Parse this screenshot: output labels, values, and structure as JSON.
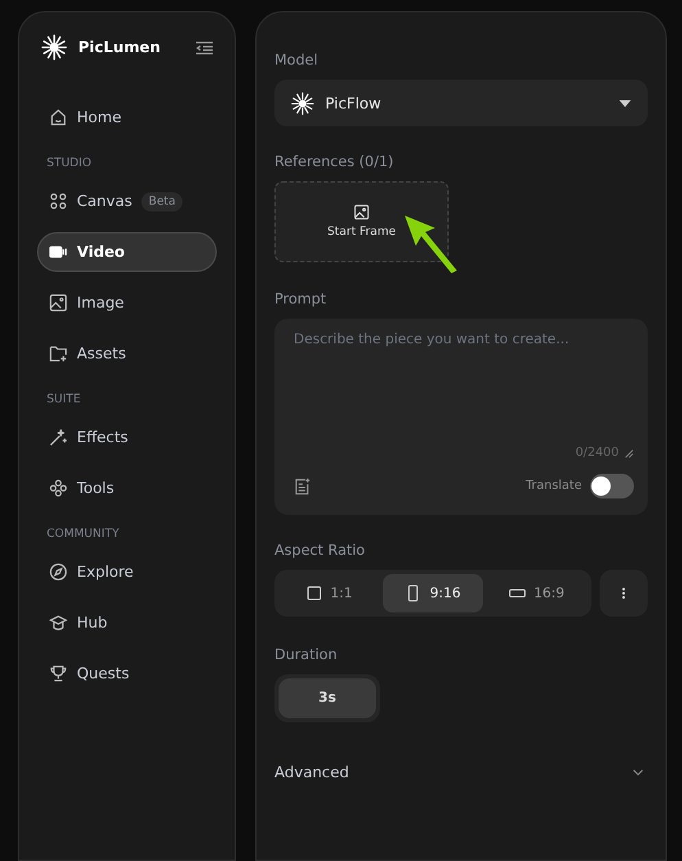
{
  "sidebar": {
    "brand": "PicLumen",
    "items": [
      {
        "kind": "item",
        "label": "Home",
        "selected": false
      },
      {
        "kind": "section",
        "label": "STUDIO"
      },
      {
        "kind": "item",
        "label": "Canvas",
        "badge": "Beta",
        "selected": false
      },
      {
        "kind": "item",
        "label": "Video",
        "selected": true
      },
      {
        "kind": "item",
        "label": "Image",
        "selected": false
      },
      {
        "kind": "item",
        "label": "Assets",
        "selected": false
      },
      {
        "kind": "section",
        "label": "SUITE"
      },
      {
        "kind": "item",
        "label": "Effects",
        "selected": false
      },
      {
        "kind": "item",
        "label": "Tools",
        "selected": false
      },
      {
        "kind": "section",
        "label": "COMMUNITY"
      },
      {
        "kind": "item",
        "label": "Explore",
        "selected": false
      },
      {
        "kind": "item",
        "label": "Hub",
        "selected": false
      },
      {
        "kind": "item",
        "label": "Quests",
        "selected": false
      }
    ]
  },
  "model": {
    "label": "Model",
    "value": "PicFlow"
  },
  "references": {
    "label": "References (0/1)",
    "slot": "Start Frame"
  },
  "prompt": {
    "label": "Prompt",
    "placeholder": "Describe the piece you want to create...",
    "counter": "0/2400",
    "translate": {
      "label": "Translate",
      "on": false
    }
  },
  "aspect_ratio": {
    "label": "Aspect Ratio",
    "options": [
      {
        "label": "1:1",
        "selected": false
      },
      {
        "label": "9:16",
        "selected": true
      },
      {
        "label": "16:9",
        "selected": false
      }
    ]
  },
  "duration": {
    "label": "Duration",
    "options": [
      {
        "label": "3s",
        "selected": true
      }
    ]
  },
  "advanced": {
    "label": "Advanced",
    "expanded": false
  }
}
